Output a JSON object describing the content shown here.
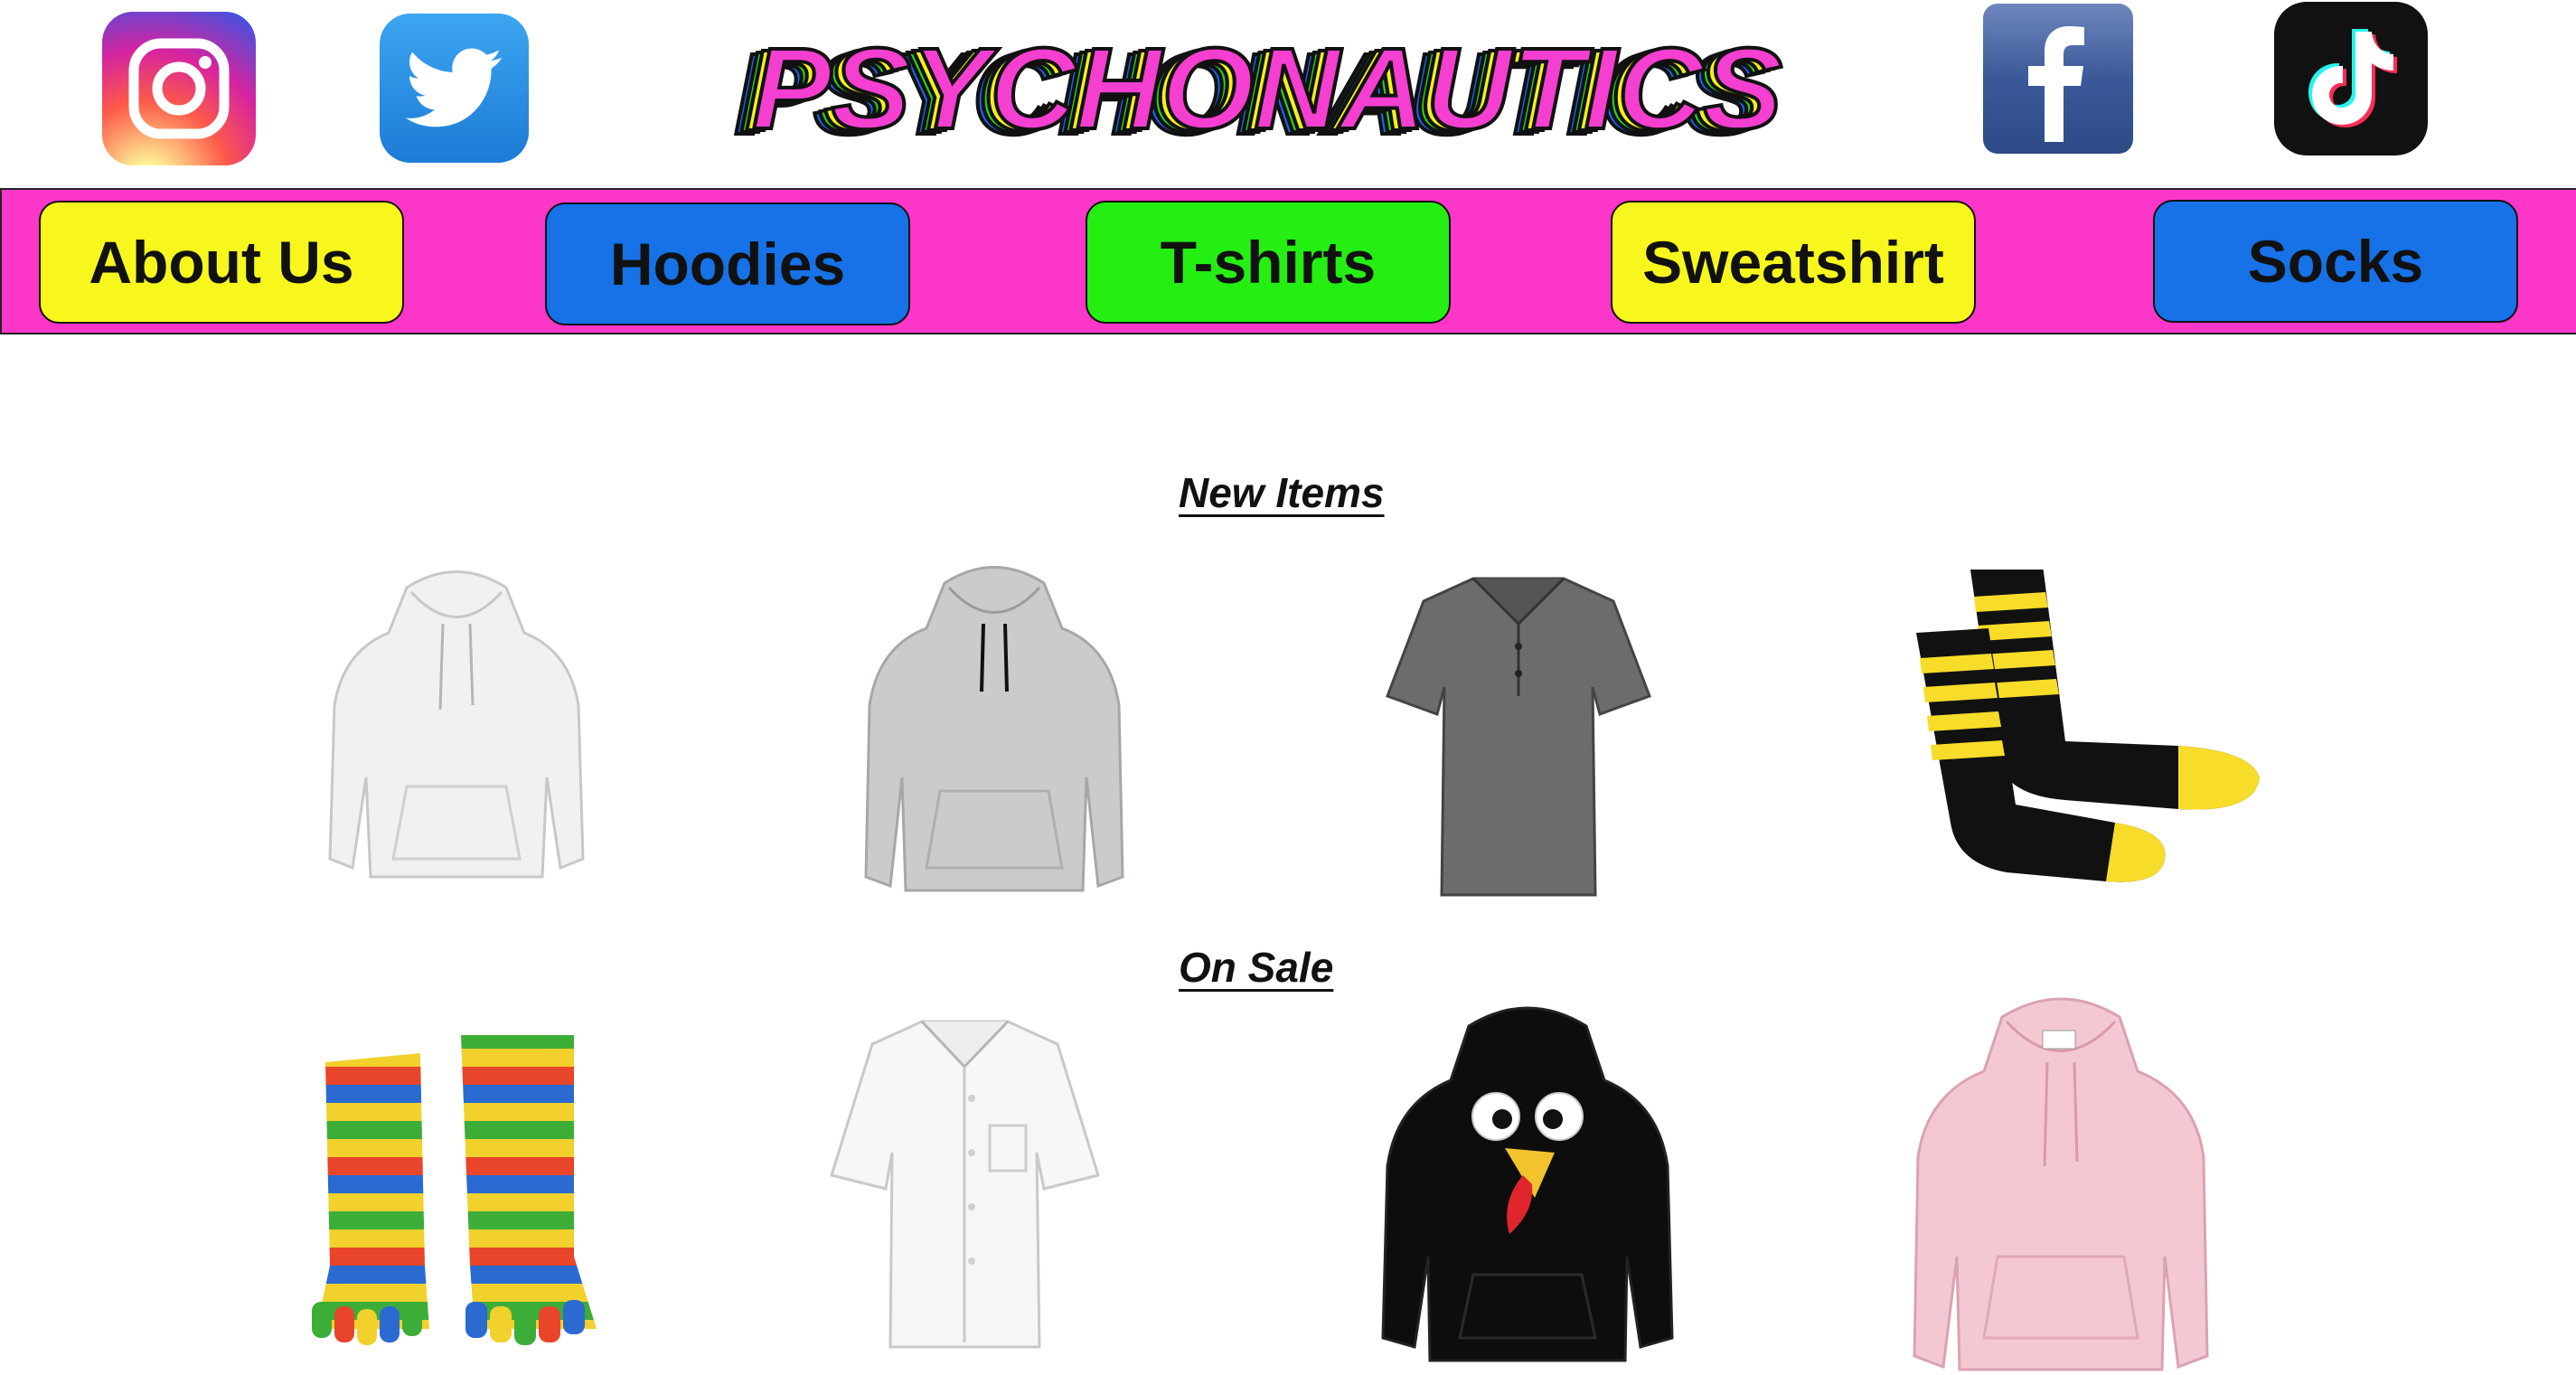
{
  "header": {
    "brand": "PSYCHONAUTICS",
    "social": [
      {
        "name": "instagram-icon"
      },
      {
        "name": "twitter-icon"
      },
      {
        "name": "facebook-icon"
      },
      {
        "name": "tiktok-icon"
      }
    ]
  },
  "nav": {
    "items": [
      {
        "label": "About Us",
        "color": "#f7f71e"
      },
      {
        "label": "Hoodies",
        "color": "#1672e6"
      },
      {
        "label": "T-shirts",
        "color": "#25ee13"
      },
      {
        "label": "Sweatshirt",
        "color": "#f7f71e"
      },
      {
        "label": "Socks",
        "color": "#1672e6"
      }
    ]
  },
  "sections": {
    "new_items": {
      "title": "New Items",
      "products": [
        "white hoodie",
        "grey hoodie",
        "grey polo shirt",
        "black and yellow striped socks"
      ]
    },
    "on_sale": {
      "title": "On Sale",
      "products": [
        "rainbow toe socks",
        "white button-down shirt",
        "black turkey hoodie",
        "pink hoodie"
      ]
    }
  },
  "colors": {
    "nav_bar": "#fb36c9",
    "logo_fill": "#f53fd0",
    "logo_shadow_yellow": "#f4f01c",
    "logo_shadow_green": "#29d31d",
    "logo_shadow_blue": "#1e63e8"
  }
}
